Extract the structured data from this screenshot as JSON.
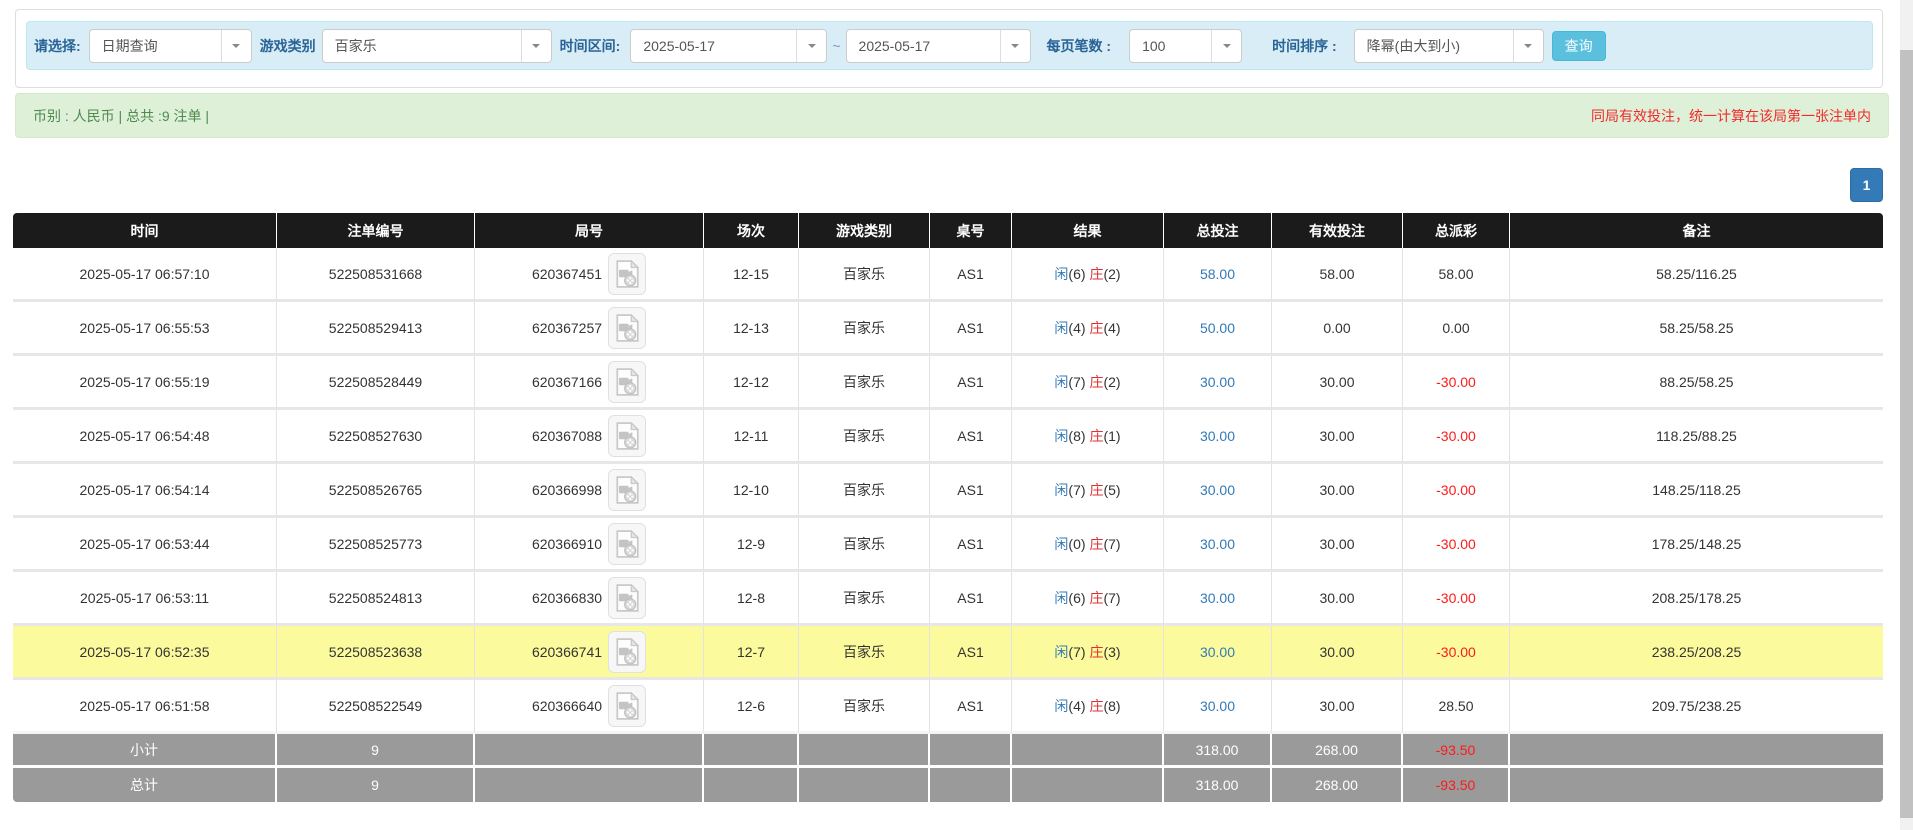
{
  "filter": {
    "query_type": {
      "label": "请选择:",
      "value": "日期查询"
    },
    "game_category": {
      "label": "游戏类别",
      "value": "百家乐"
    },
    "date_range": {
      "label": "时间区间:",
      "from": "2025-05-17",
      "separator": "~",
      "to": "2025-05-17"
    },
    "page_size": {
      "label": "每页笔数 :",
      "value": "100"
    },
    "sort": {
      "label": "时间排序 :",
      "value": "降幂(由大到小)"
    },
    "search_button": "查询"
  },
  "summary": {
    "left": "币别 : 人民币 | 总共 :9 注单 |",
    "right_notice": "同局有效投注，统一计算在该局第一张注单内"
  },
  "pagination": {
    "current": "1"
  },
  "table": {
    "headers": [
      "时间",
      "注单编号",
      "局号",
      "场次",
      "游戏类别",
      "桌号",
      "结果",
      "总投注",
      "有效投注",
      "总派彩",
      "备注"
    ],
    "rows": [
      {
        "time": "2025-05-17 06:57:10",
        "bet_id": "522508531668",
        "round_id": "620367451",
        "session": "12-15",
        "game": "百家乐",
        "table_no": "AS1",
        "result_player_label": "闲",
        "result_player_value": "(6)",
        "result_banker_label": "庄",
        "result_banker_value": "(2)",
        "total_bet": "58.00",
        "valid_bet": "58.00",
        "payout": "58.00",
        "remark": "58.25/116.25",
        "highlighted": false
      },
      {
        "time": "2025-05-17 06:55:53",
        "bet_id": "522508529413",
        "round_id": "620367257",
        "session": "12-13",
        "game": "百家乐",
        "table_no": "AS1",
        "result_player_label": "闲",
        "result_player_value": "(4)",
        "result_banker_label": "庄",
        "result_banker_value": "(4)",
        "total_bet": "50.00",
        "valid_bet": "0.00",
        "payout": "0.00",
        "remark": "58.25/58.25",
        "highlighted": false
      },
      {
        "time": "2025-05-17 06:55:19",
        "bet_id": "522508528449",
        "round_id": "620367166",
        "session": "12-12",
        "game": "百家乐",
        "table_no": "AS1",
        "result_player_label": "闲",
        "result_player_value": "(7)",
        "result_banker_label": "庄",
        "result_banker_value": "(2)",
        "total_bet": "30.00",
        "valid_bet": "30.00",
        "payout": "-30.00",
        "remark": "88.25/58.25",
        "highlighted": false
      },
      {
        "time": "2025-05-17 06:54:48",
        "bet_id": "522508527630",
        "round_id": "620367088",
        "session": "12-11",
        "game": "百家乐",
        "table_no": "AS1",
        "result_player_label": "闲",
        "result_player_value": "(8)",
        "result_banker_label": "庄",
        "result_banker_value": "(1)",
        "total_bet": "30.00",
        "valid_bet": "30.00",
        "payout": "-30.00",
        "remark": "118.25/88.25",
        "highlighted": false
      },
      {
        "time": "2025-05-17 06:54:14",
        "bet_id": "522508526765",
        "round_id": "620366998",
        "session": "12-10",
        "game": "百家乐",
        "table_no": "AS1",
        "result_player_label": "闲",
        "result_player_value": "(7)",
        "result_banker_label": "庄",
        "result_banker_value": "(5)",
        "total_bet": "30.00",
        "valid_bet": "30.00",
        "payout": "-30.00",
        "remark": "148.25/118.25",
        "highlighted": false
      },
      {
        "time": "2025-05-17 06:53:44",
        "bet_id": "522508525773",
        "round_id": "620366910",
        "session": "12-9",
        "game": "百家乐",
        "table_no": "AS1",
        "result_player_label": "闲",
        "result_player_value": "(0)",
        "result_banker_label": "庄",
        "result_banker_value": "(7)",
        "total_bet": "30.00",
        "valid_bet": "30.00",
        "payout": "-30.00",
        "remark": "178.25/148.25",
        "highlighted": false
      },
      {
        "time": "2025-05-17 06:53:11",
        "bet_id": "522508524813",
        "round_id": "620366830",
        "session": "12-8",
        "game": "百家乐",
        "table_no": "AS1",
        "result_player_label": "闲",
        "result_player_value": "(6)",
        "result_banker_label": "庄",
        "result_banker_value": "(7)",
        "total_bet": "30.00",
        "valid_bet": "30.00",
        "payout": "-30.00",
        "remark": "208.25/178.25",
        "highlighted": false
      },
      {
        "time": "2025-05-17 06:52:35",
        "bet_id": "522508523638",
        "round_id": "620366741",
        "session": "12-7",
        "game": "百家乐",
        "table_no": "AS1",
        "result_player_label": "闲",
        "result_player_value": "(7)",
        "result_banker_label": "庄",
        "result_banker_value": "(3)",
        "total_bet": "30.00",
        "valid_bet": "30.00",
        "payout": "-30.00",
        "remark": "238.25/208.25",
        "highlighted": true
      },
      {
        "time": "2025-05-17 06:51:58",
        "bet_id": "522508522549",
        "round_id": "620366640",
        "session": "12-6",
        "game": "百家乐",
        "table_no": "AS1",
        "result_player_label": "闲",
        "result_player_value": "(4)",
        "result_banker_label": "庄",
        "result_banker_value": "(8)",
        "total_bet": "30.00",
        "valid_bet": "30.00",
        "payout": "28.50",
        "remark": "209.75/238.25",
        "highlighted": false
      }
    ],
    "subtotal": {
      "label": "小计",
      "count": "9",
      "total_bet": "318.00",
      "valid_bet": "268.00",
      "payout": "-93.50"
    },
    "total": {
      "label": "总计",
      "count": "9",
      "total_bet": "318.00",
      "valid_bet": "268.00",
      "payout": "-93.50"
    }
  },
  "colors": {
    "accent_blue": "#337ab7",
    "banker_red": "#e03131",
    "negative_red": "#ff1a1a",
    "highlight_yellow": "#fbfb9e",
    "header_black": "#1b1b1b",
    "footer_gray": "#9a9a9a",
    "filter_bar_blue": "#d9edf7",
    "summary_green": "#dff0d8",
    "search_btn_cyan": "#5bc0de"
  }
}
